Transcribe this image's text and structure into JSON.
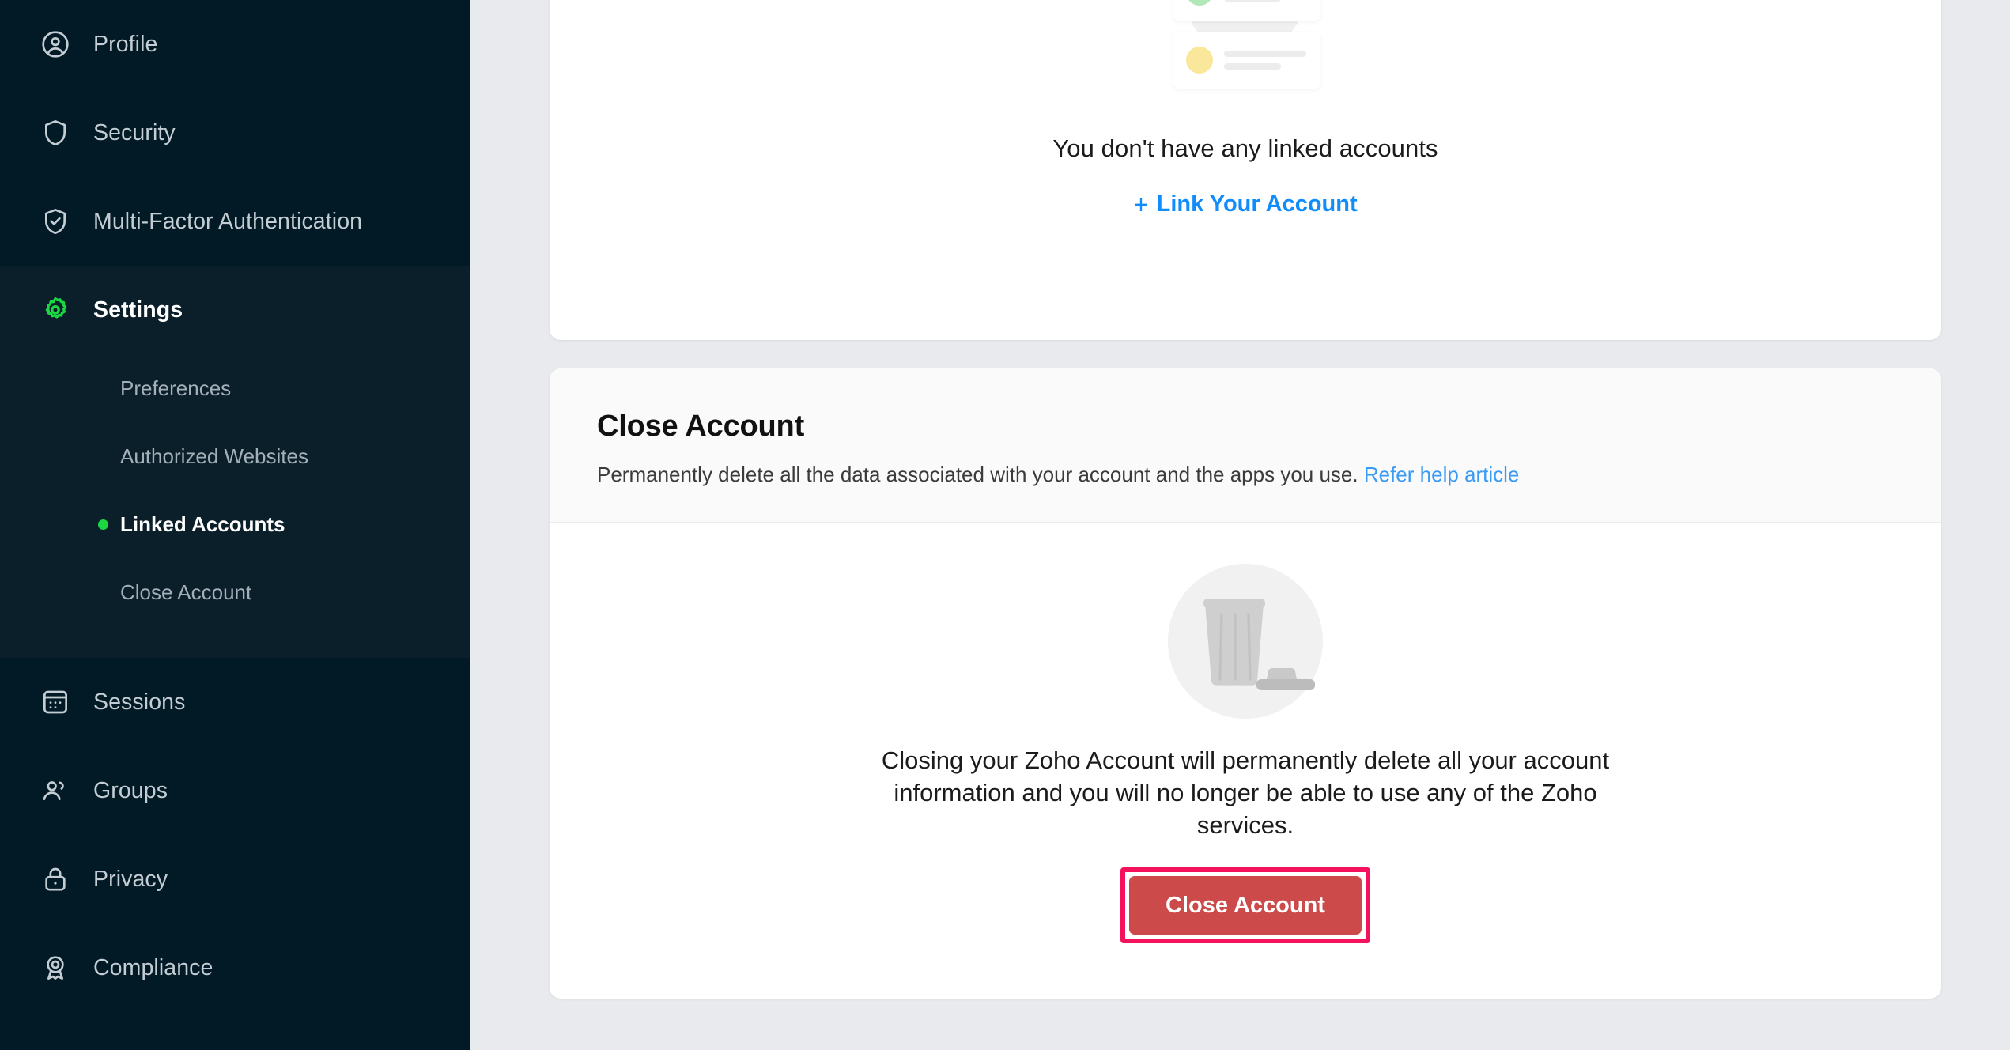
{
  "colors": {
    "sidebar_bg": "#011a26",
    "sidebar_group_bg": "#0b1f2b",
    "accent_green": "#1bd742",
    "link_blue": "#108cfb",
    "help_link_blue": "#3a9bf4",
    "danger_button": "#cc4a4a",
    "highlight_border": "#f4125c",
    "content_bg": "#e8eaed",
    "card_bg": "#ffffff",
    "card_head_bg": "#fafafa"
  },
  "sidebar": {
    "items": [
      {
        "label": "Profile",
        "icon": "user-circle-icon",
        "active": false
      },
      {
        "label": "Security",
        "icon": "shield-icon",
        "active": false
      },
      {
        "label": "Multi-Factor Authentication",
        "icon": "shield-check-icon",
        "active": false
      },
      {
        "label": "Settings",
        "icon": "gear-icon",
        "active": true
      },
      {
        "label": "Sessions",
        "icon": "window-sessions-icon",
        "active": false
      },
      {
        "label": "Groups",
        "icon": "users-icon",
        "active": false
      },
      {
        "label": "Privacy",
        "icon": "lock-icon",
        "active": false
      },
      {
        "label": "Compliance",
        "icon": "award-ribbon-icon",
        "active": false
      }
    ],
    "settings_submenu": [
      {
        "label": "Preferences",
        "active": false
      },
      {
        "label": "Authorized Websites",
        "active": false
      },
      {
        "label": "Linked Accounts",
        "active": true
      },
      {
        "label": "Close Account",
        "active": false
      }
    ]
  },
  "linked_accounts_card": {
    "illustration": "linked-accounts-empty-illustration",
    "empty_title": "You don't have any linked accounts",
    "link_label": "Link Your Account",
    "link_plus": "+",
    "row_avatar_colors": [
      "#f9b6bd",
      "#b3e6b9",
      "#fae79b"
    ]
  },
  "close_account_card": {
    "title": "Close Account",
    "description_prefix": "Permanently delete all the data associated with your account and the apps you use.",
    "help_link_label": "Refer help article",
    "illustration": "trash-can-illustration",
    "body_text": "Closing your Zoho Account will permanently delete all your account information and you will no longer be able to use any of the Zoho services.",
    "button_label": "Close Account"
  }
}
